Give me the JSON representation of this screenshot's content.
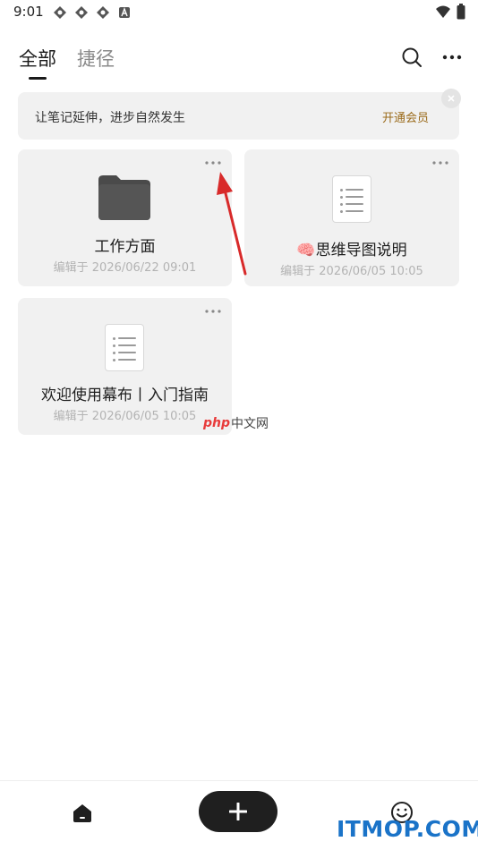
{
  "status_bar": {
    "time": "9:01",
    "left_icons": [
      "app-icon",
      "app-icon",
      "app-icon",
      "a-icon"
    ],
    "right_icons": [
      "wifi-icon",
      "battery-icon"
    ]
  },
  "header": {
    "tabs": [
      {
        "label": "全部",
        "active": true
      },
      {
        "label": "捷径",
        "active": false
      }
    ],
    "actions": [
      "search-icon",
      "more-icon"
    ]
  },
  "banner": {
    "text": "让笔记延伸，进步自然发生",
    "link": "开通会员",
    "link_color": "#9a6a1a"
  },
  "cards": [
    {
      "type": "folder",
      "title": "工作方面",
      "meta": "编辑于 2026/06/22 09:01"
    },
    {
      "type": "mindmap",
      "emoji": "🧠",
      "title": "思维导图说明",
      "meta": "编辑于 2026/06/05 10:05"
    },
    {
      "type": "document",
      "title": "欢迎使用幕布丨入门指南",
      "meta": "编辑于 2026/06/05 10:05"
    }
  ],
  "watermarks": {
    "php_prefix": "php",
    "php_suffix": "中文网",
    "itmop": "ITMOP.COM"
  },
  "bottom_nav": [
    "home-icon",
    "plus-icon",
    "smiley-icon"
  ],
  "colors": {
    "card_bg": "#f1f1f1",
    "accent_dark": "#1f1f1f",
    "arrow": "#d82a2a",
    "meta_text": "#b3b3b3"
  }
}
